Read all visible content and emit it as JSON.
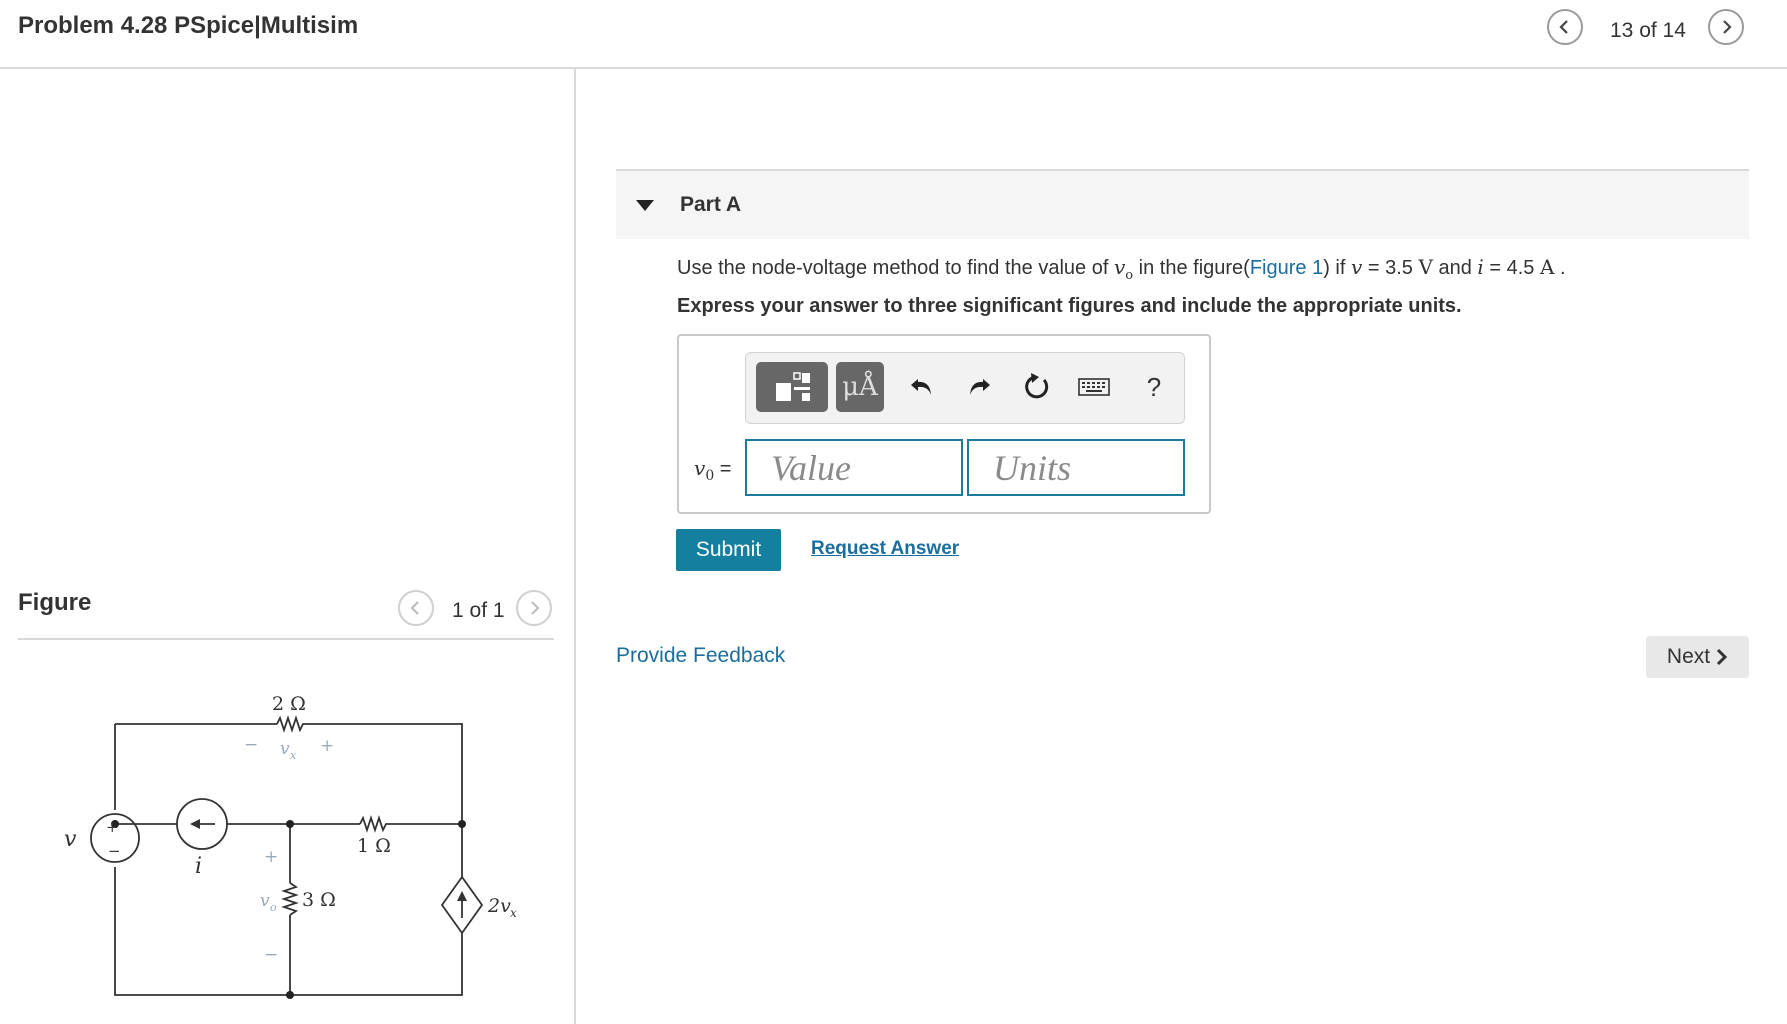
{
  "header": {
    "title": "Problem 4.28 PSpice|Multisim",
    "counter": "13 of 14"
  },
  "figure": {
    "label": "Figure",
    "counter": "1 of 1",
    "circuit_labels": {
      "r_top": "2 Ω",
      "r_mid": "1 Ω",
      "r_down": "3 Ω",
      "vx": "v",
      "vx_sub": "x",
      "vo": "v",
      "vo_sub": "o",
      "v_src": "v",
      "i_src": "i",
      "dep_src": "2v",
      "dep_sub": "x",
      "plus": "+",
      "minus": "−"
    }
  },
  "part_a": {
    "title": "Part A",
    "question": {
      "pre": "Use the node-voltage method to find the value of ",
      "var1": "v",
      "var1_sub": "o",
      "mid1": " in the figure(",
      "link": "Figure 1",
      "mid2": ") if ",
      "var2": "v",
      "eq1": " = 3.5 ",
      "unit1": "V",
      "and": " and ",
      "var3": "i",
      "eq2": " = 4.5 ",
      "unit2": "A",
      "end": " ."
    },
    "instruction": "Express your answer to three significant figures and include the appropriate units.",
    "answer_label": "v",
    "answer_label_sub": "0",
    "answer_label_eq": " =",
    "value_placeholder": "Value",
    "units_placeholder": "Units",
    "toolbar": {
      "units_btn": "μÅ",
      "help": "?"
    },
    "submit": "Submit",
    "request": "Request Answer"
  },
  "footer": {
    "feedback": "Provide Feedback",
    "next": "Next"
  }
}
